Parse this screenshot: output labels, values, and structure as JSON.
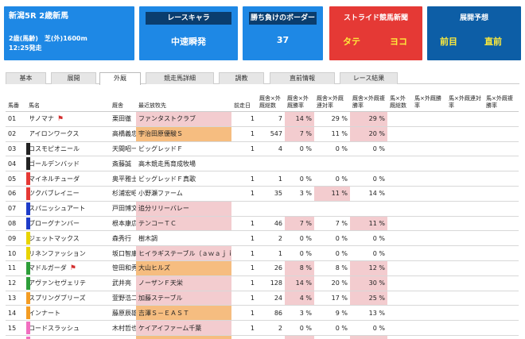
{
  "race_card": {
    "title": "新潟5R 2歳新馬",
    "condition": "2歳(馬齢)　芝(外)1600m",
    "post_time": "12:25発走"
  },
  "chara_card": {
    "heading": "レースキャラ",
    "value": "中速瞬発"
  },
  "border_card": {
    "heading": "勝ち負けのボーダー",
    "value": "37"
  },
  "news_card": {
    "heading": "ストライド競馬新聞",
    "left": "タテ",
    "right": "ヨコ"
  },
  "predict_card": {
    "heading": "展開予想",
    "left": "前目",
    "right": "直前"
  },
  "tabs": [
    {
      "label": "基本"
    },
    {
      "label": "展開"
    },
    {
      "label": "外厩"
    },
    {
      "label": "競走馬詳細"
    },
    {
      "label": "調教"
    },
    {
      "label": "直前情報"
    },
    {
      "label": "レース結果"
    }
  ],
  "active_tab": "外厩",
  "columns": {
    "umaban": "馬番",
    "name": "馬名",
    "trainer": "厩舎",
    "farm": "最近放牧先",
    "interval": "前走日",
    "c1": "厩舎×外厩総数",
    "c2": "厩舎×外厩勝率",
    "c3": "厩舎×外厩連対率",
    "c4": "厩舎×外厩複勝率",
    "c5": "馬×外厩総数",
    "c6": "馬×外厩勝率",
    "c7": "馬×外厩連対率",
    "c8": "馬×外厩複勝率"
  },
  "rows": [
    {
      "no": "01",
      "name": "サノマナ",
      "trainer": "栗田徹",
      "farm": "ファンタストクラブ",
      "interval": "1",
      "total": "7",
      "win": "14 %",
      "ren": "29 %",
      "fuku": "29 %",
      "flag": true
    },
    {
      "no": "02",
      "name": "アイロンワークス",
      "trainer": "高橋義忠",
      "farm": "宇治田原優駿Ｓ",
      "interval": "1",
      "total": "547",
      "win": "7 %",
      "ren": "11 %",
      "fuku": "20 %",
      "flag": false
    },
    {
      "no": "03",
      "name": "コスモピオニール",
      "trainer": "天間昭一",
      "farm": "ビッグレッドＦ",
      "interval": "1",
      "total": "4",
      "win": "0 %",
      "ren": "0 %",
      "fuku": "0 %",
      "flag": false
    },
    {
      "no": "04",
      "name": "ゴールデンバッド",
      "trainer": "斎藤誠",
      "farm": "高木競走馬育成牧場",
      "interval": "",
      "total": "",
      "win": "",
      "ren": "",
      "fuku": "",
      "flag": false
    },
    {
      "no": "05",
      "name": "マイネルチューダ",
      "trainer": "奥平雅士",
      "farm": "ビッグレッドＦ真歌",
      "interval": "1",
      "total": "1",
      "win": "0 %",
      "ren": "0 %",
      "fuku": "0 %",
      "flag": false
    },
    {
      "no": "06",
      "name": "ツクバブレイニー",
      "trainer": "杉浦宏昭",
      "farm": "小野瀬ファーム",
      "interval": "1",
      "total": "35",
      "win": "3 %",
      "ren": "11 %",
      "fuku": "14 %",
      "flag": false
    },
    {
      "no": "07",
      "name": "スパニッシュアート",
      "trainer": "戸田博文",
      "farm": "追分リリーバレー",
      "interval": "",
      "total": "",
      "win": "",
      "ren": "",
      "fuku": "",
      "flag": false
    },
    {
      "no": "08",
      "name": "ブローグナンバー",
      "trainer": "根本康広",
      "farm": "テンコーＴＣ",
      "interval": "1",
      "total": "46",
      "win": "7 %",
      "ren": "7 %",
      "fuku": "11 %",
      "flag": false
    },
    {
      "no": "09",
      "name": "ジェットマックス",
      "trainer": "森秀行",
      "farm": "樹木調",
      "interval": "1",
      "total": "2",
      "win": "0 %",
      "ren": "0 %",
      "fuku": "0 %",
      "flag": false
    },
    {
      "no": "10",
      "name": "リネンファッション",
      "trainer": "坂口智康",
      "farm": "ヒイラギステーブル（ａｗａｊｉ）",
      "interval": "1",
      "total": "1",
      "win": "0 %",
      "ren": "0 %",
      "fuku": "0 %",
      "flag": false
    },
    {
      "no": "11",
      "name": "マドルガーダ",
      "trainer": "笹田和秀",
      "farm": "大山ヒルズ",
      "interval": "1",
      "total": "26",
      "win": "8 %",
      "ren": "8 %",
      "fuku": "12 %",
      "flag": true
    },
    {
      "no": "12",
      "name": "アヴァンセヴェリテ",
      "trainer": "武井亮",
      "farm": "ノーザンＦ天栄",
      "interval": "1",
      "total": "128",
      "win": "14 %",
      "ren": "20 %",
      "fuku": "30 %",
      "flag": false
    },
    {
      "no": "13",
      "name": "スプリングブリーズ",
      "trainer": "萱野浩二",
      "farm": "加藤ステーブル",
      "interval": "1",
      "total": "24",
      "win": "4 %",
      "ren": "17 %",
      "fuku": "25 %",
      "flag": false
    },
    {
      "no": "14",
      "name": "インナート",
      "trainer": "藤原辰雄",
      "farm": "吉澤Ｓ－ＥＡＳＴ",
      "interval": "1",
      "total": "86",
      "win": "3 %",
      "ren": "9 %",
      "fuku": "13 %",
      "flag": false
    },
    {
      "no": "15",
      "name": "ロードスラッシュ",
      "trainer": "木村哲也",
      "farm": "ケイアイファーム千葉",
      "interval": "1",
      "total": "2",
      "win": "0 %",
      "ren": "0 %",
      "fuku": "0 %",
      "flag": false
    },
    {
      "no": "16",
      "name": "クロワルース",
      "trainer": "吉岡慎明",
      "farm": "ノーザンＦ天栄",
      "interval": "1",
      "total": "217",
      "win": "13 %",
      "ren": "25 %",
      "fuku": "34 %",
      "flag": false
    }
  ],
  "colors": {
    "card_blue": "#1e88e5",
    "card_red": "#e53935",
    "card_navy": "#0d5ea6",
    "waku_1": "#ffffff",
    "waku_2": "#222222",
    "waku_3": "#e53935",
    "waku_4": "#1e3cc8",
    "waku_5": "#e8d400",
    "waku_6": "#2e9e3a",
    "waku_7": "#f39c24",
    "waku_8": "#f16fc0",
    "farm_pink": "#f3cccf",
    "farm_orange": "#f6bd80"
  }
}
